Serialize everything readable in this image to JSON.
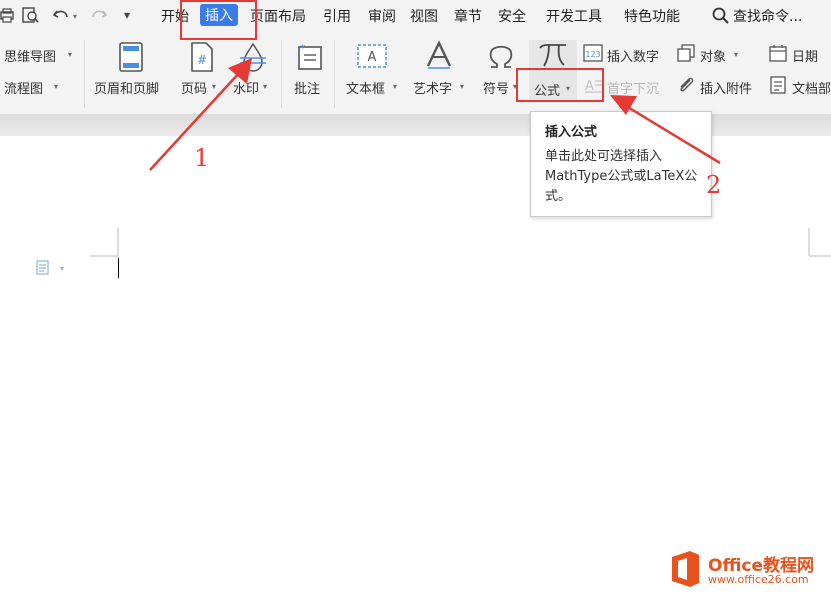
{
  "quick_access": {
    "undo_caret": "▾",
    "more": "▾"
  },
  "menu": {
    "items": [
      "开始",
      "插入",
      "页面布局",
      "引用",
      "审阅",
      "视图",
      "章节",
      "安全",
      "开发工具",
      "特色功能"
    ],
    "active_index": 1,
    "search": "查找命令..."
  },
  "ribbon": {
    "mindmap": "思维导图",
    "flowchart": "流程图",
    "header_footer": "页眉和页脚",
    "page_number": "页码",
    "watermark": "水印",
    "comment": "批注",
    "textbox": "文本框",
    "wordart": "艺术字",
    "symbol": "符号",
    "formula": "公式",
    "insert_number": "插入数字",
    "object": "对象",
    "date": "日期",
    "drop_cap": "首字下沉",
    "attachment": "插入附件",
    "doc_part": "文档部"
  },
  "tooltip": {
    "title": "插入公式",
    "body": "单击此处可选择插入MathType公式或LaTeX公式。"
  },
  "annotations": {
    "label1": "1",
    "label2": "2"
  },
  "watermark_logo": {
    "name": "Office教程网",
    "url": "www.office26.com"
  },
  "colors": {
    "accent": "#3b7be9",
    "annotation": "#e53935",
    "logo": "#e8531d"
  }
}
